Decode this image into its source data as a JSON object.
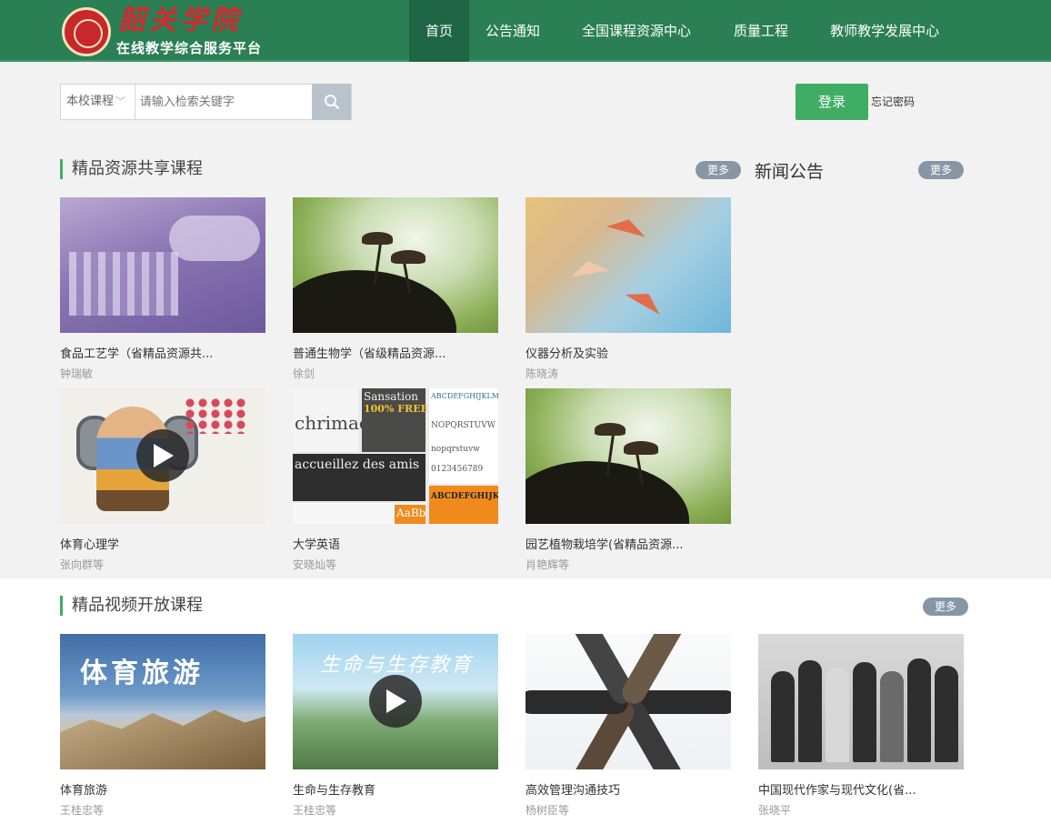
{
  "header": {
    "logo_title": "韶关学院",
    "logo_sub": "在线教学综合服务平台",
    "nav": [
      "首页",
      "公告通知",
      "全国课程资源中心",
      "质量工程",
      "教师教学发展中心"
    ]
  },
  "search": {
    "scope": "本校课程",
    "placeholder": "请输入检索关键字"
  },
  "login": {
    "label": "登录",
    "forgot": "忘记密码"
  },
  "section1": {
    "title": "精品资源共享课程",
    "more": "更多",
    "courses": [
      {
        "title": "食品工艺学（省精品资源共...",
        "author": "钟瑞敏"
      },
      {
        "title": "普通生物学（省级精品资源...",
        "author": "徐剑"
      },
      {
        "title": "仪器分析及实验",
        "author": "陈晓涛"
      },
      {
        "title": "体育心理学",
        "author": "张向群等"
      },
      {
        "title": "大学英语",
        "author": "安晓灿等"
      },
      {
        "title": "园艺植物栽培学(省精品资源...",
        "author": "肖艳辉等"
      }
    ]
  },
  "news": {
    "title": "新闻公告",
    "more": "更多"
  },
  "section2": {
    "title": "精品视频开放课程",
    "more": "更多",
    "courses": [
      {
        "title": "体育旅游",
        "author": "王桂忠等",
        "thumb_text": "体育旅游"
      },
      {
        "title": "生命与生存教育",
        "author": "王桂忠等",
        "thumb_text": "生命与生存教育"
      },
      {
        "title": "高效管理沟通技巧",
        "author": "杨树臣等"
      },
      {
        "title": "中国现代作家与现代文化(省...",
        "author": "张晓平"
      }
    ]
  },
  "thumb_texts": {
    "eng1": "chrimae",
    "eng2": "Sansation",
    "eng3": "100% FREE",
    "eng4": "accueillez des amis",
    "eng5": "ABCDEFGHIJKLM",
    "eng6": "NOPQRSTUVW",
    "eng7": "nopqrstuvw",
    "eng8": "0123456789",
    "eng9": "ABCDEFGHIJKL",
    "eng10": "AaBb"
  },
  "colors": {
    "header": "#2a7f55",
    "accent": "#3fad63",
    "more_badge": "#8696a6"
  }
}
